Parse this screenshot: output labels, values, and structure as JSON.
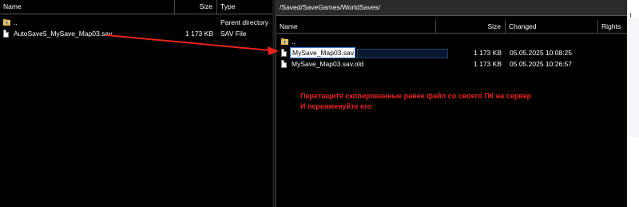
{
  "left": {
    "columns": {
      "name": "Name",
      "size": "Size",
      "type": "Type"
    },
    "rows": [
      {
        "name": "..",
        "size": "",
        "type": "Parent directory",
        "icon": "folder-up-icon"
      },
      {
        "name": "AutoSave5_MySave_Map03.sav",
        "size": "1 173 KB",
        "type": "SAV File",
        "icon": "file-icon"
      }
    ]
  },
  "right": {
    "path": "/Saved/SaveGames/WorldSaves/",
    "columns": {
      "name": "Name",
      "size": "Size",
      "changed": "Changed",
      "rights": "Rights"
    },
    "rows": [
      {
        "name": "..",
        "size": "",
        "changed": "",
        "icon": "folder-up-icon"
      },
      {
        "name": "MySave_Map03.sav",
        "size": "1 173 KB",
        "changed": "05.05.2025 10:08:25",
        "icon": "file-icon",
        "renaming": true
      },
      {
        "name": "MySave_Map03.sav.old",
        "size": "1 173 KB",
        "changed": "05.05.2025 10:26:57",
        "icon": "file-icon"
      }
    ]
  },
  "annotation": {
    "line1": "Перетащите скопированные ранее файл со своего ПК на сервер",
    "line2": "И переименуйте его",
    "color": "#e8231e"
  },
  "colors": {
    "background": "#000000",
    "arrow": "#e8231e",
    "rename_border": "#3a7bd5"
  }
}
